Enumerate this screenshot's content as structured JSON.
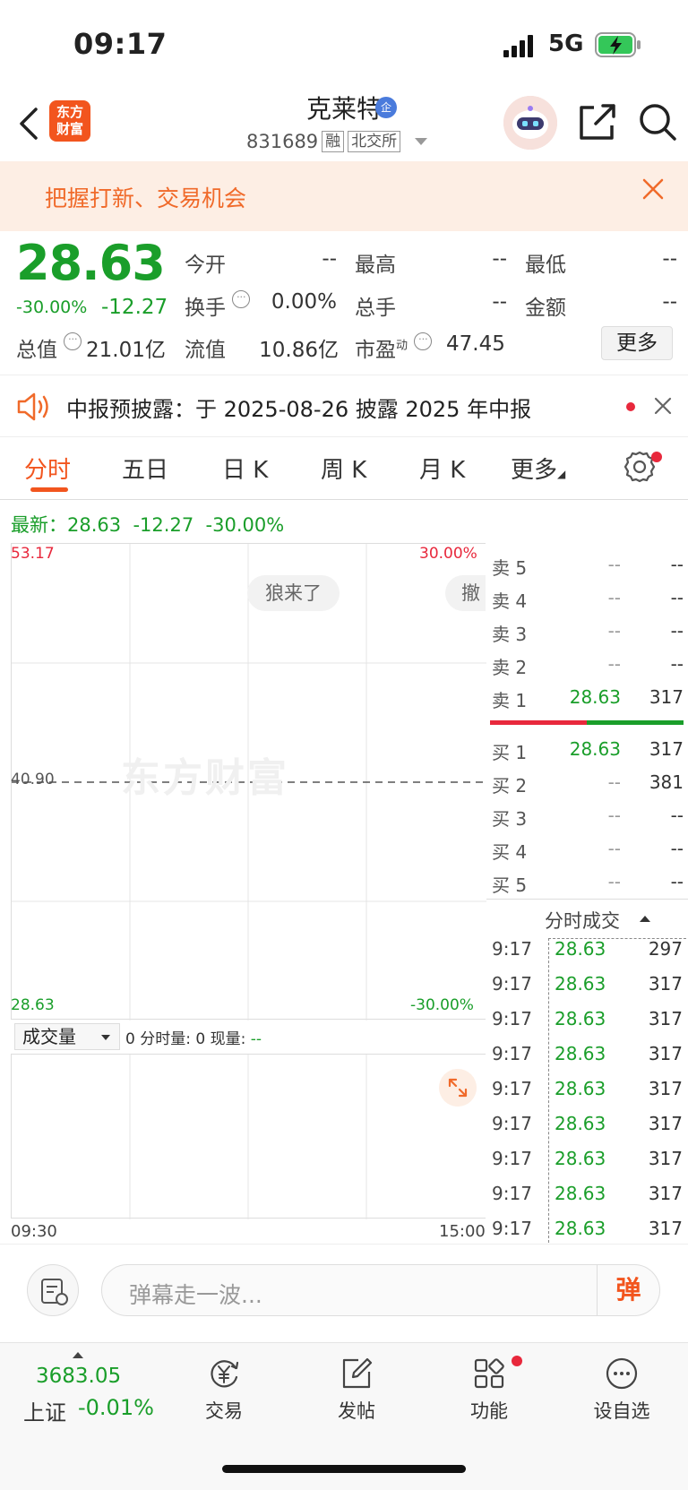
{
  "status": {
    "time": "09:17",
    "network": "5G"
  },
  "header": {
    "logo_line1": "东方",
    "logo_line2": "财富",
    "stock_name": "克莱特",
    "ent_badge": "企",
    "stock_code": "831689",
    "tag_margin": "融",
    "tag_exchange": "北交所"
  },
  "banner": {
    "text": "把握打新、交易机会"
  },
  "quote": {
    "price": "28.63",
    "change_pct": "-30.00%",
    "change_val": "-12.27",
    "fields": {
      "open_label": "今开",
      "open": "--",
      "high_label": "最高",
      "high": "--",
      "low_label": "最低",
      "low": "--",
      "turnover_label": "换手",
      "turnover": "0.00%",
      "volume_label": "总手",
      "volume": "--",
      "amount_label": "金额",
      "amount": "--",
      "mcap_label": "总值",
      "mcap": "21.01亿",
      "float_label": "流值",
      "float": "10.86亿",
      "pe_label": "市盈",
      "pe_sup": "动",
      "pe": "47.45"
    },
    "more_button": "更多"
  },
  "announcement": {
    "text": "中报预披露：于 2025-08-26 披露 2025 年中报"
  },
  "tabs": [
    {
      "label": "分时"
    },
    {
      "label": "五日"
    },
    {
      "label": "日 K"
    },
    {
      "label": "周 K"
    },
    {
      "label": "月 K"
    },
    {
      "label": "更多"
    }
  ],
  "latest": {
    "label": "最新：",
    "price": "28.63",
    "change": "-12.27",
    "pct": "-30.00%"
  },
  "chart": {
    "y_top": "53.17",
    "y_mid": "40.90",
    "y_bottom": "28.63",
    "pct_top": "30.00%",
    "pct_bottom": "-30.00%",
    "watermark": "东方财富",
    "pill1": "狼来了",
    "pill2": "撤",
    "volume_selector": "成交量",
    "volume_info_prefix": "0 分时量: 0 现量: ",
    "volume_info_value": "--",
    "time_start": "09:30",
    "time_end": "15:00",
    "accent_red": "#e8283c",
    "accent_green": "#1a9e2a"
  },
  "orderbook": {
    "asks": [
      {
        "label": "卖 5",
        "price": "--",
        "vol": "--"
      },
      {
        "label": "卖 4",
        "price": "--",
        "vol": "--"
      },
      {
        "label": "卖 3",
        "price": "--",
        "vol": "--"
      },
      {
        "label": "卖 2",
        "price": "--",
        "vol": "--"
      },
      {
        "label": "卖 1",
        "price": "28.63",
        "vol": "317"
      }
    ],
    "bids": [
      {
        "label": "买 1",
        "price": "28.63",
        "vol": "317"
      },
      {
        "label": "买 2",
        "price": "--",
        "vol": "381"
      },
      {
        "label": "买 3",
        "price": "--",
        "vol": "--"
      },
      {
        "label": "买 4",
        "price": "--",
        "vol": "--"
      },
      {
        "label": "买 5",
        "price": "--",
        "vol": "--"
      }
    ]
  },
  "ticks": {
    "header": "分时成交",
    "rows": [
      {
        "time": "9:17",
        "price": "28.63",
        "vol": "297"
      },
      {
        "time": "9:17",
        "price": "28.63",
        "vol": "317"
      },
      {
        "time": "9:17",
        "price": "28.63",
        "vol": "317"
      },
      {
        "time": "9:17",
        "price": "28.63",
        "vol": "317"
      },
      {
        "time": "9:17",
        "price": "28.63",
        "vol": "317"
      },
      {
        "time": "9:17",
        "price": "28.63",
        "vol": "317"
      },
      {
        "time": "9:17",
        "price": "28.63",
        "vol": "317"
      },
      {
        "time": "9:17",
        "price": "28.63",
        "vol": "317"
      },
      {
        "time": "9:17",
        "price": "28.63",
        "vol": "317"
      }
    ]
  },
  "comment": {
    "placeholder": "弹幕走一波...",
    "danmu": "弹"
  },
  "bottom_nav": {
    "index_value": "3683.05",
    "index_name": "上证",
    "index_change": "-0.01%",
    "items": [
      {
        "label": "交易",
        "icon": "trade-yuan-icon"
      },
      {
        "label": "发帖",
        "icon": "edit-post-icon"
      },
      {
        "label": "功能",
        "icon": "grid-apps-icon"
      },
      {
        "label": "设自选",
        "icon": "more-dots-icon"
      }
    ]
  }
}
